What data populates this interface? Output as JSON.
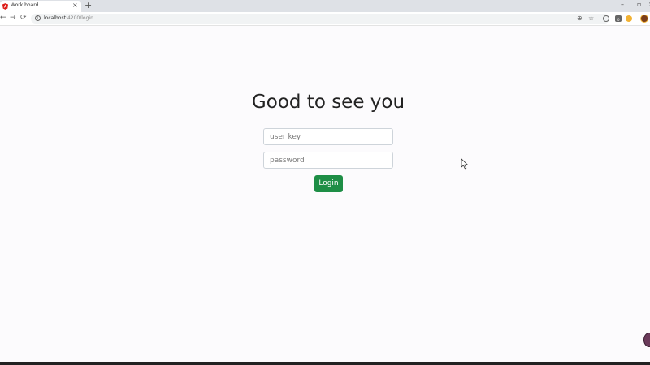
{
  "browser": {
    "tab": {
      "title": "Work board",
      "close_icon": "close-icon",
      "favicon": "angular-icon"
    },
    "new_tab_icon": "plus-icon",
    "window_controls": {
      "minimize": "–",
      "maximize": "▫",
      "close": "×"
    },
    "address": {
      "host": "localhost",
      "path": ":4200/login"
    },
    "icons": {
      "back": "←",
      "forward": "→",
      "reload": "⟳",
      "info": "i",
      "zoom": "⊕",
      "star": "☆"
    },
    "extensions": {
      "badge_count": "0"
    }
  },
  "login": {
    "heading": "Good to see you",
    "user_key_placeholder": "user key",
    "password_placeholder": "password",
    "login_label": "Login"
  },
  "colors": {
    "button_bg": "#1e8e46",
    "page_bg": "#fcfbfd",
    "heading_text": "#222222"
  }
}
